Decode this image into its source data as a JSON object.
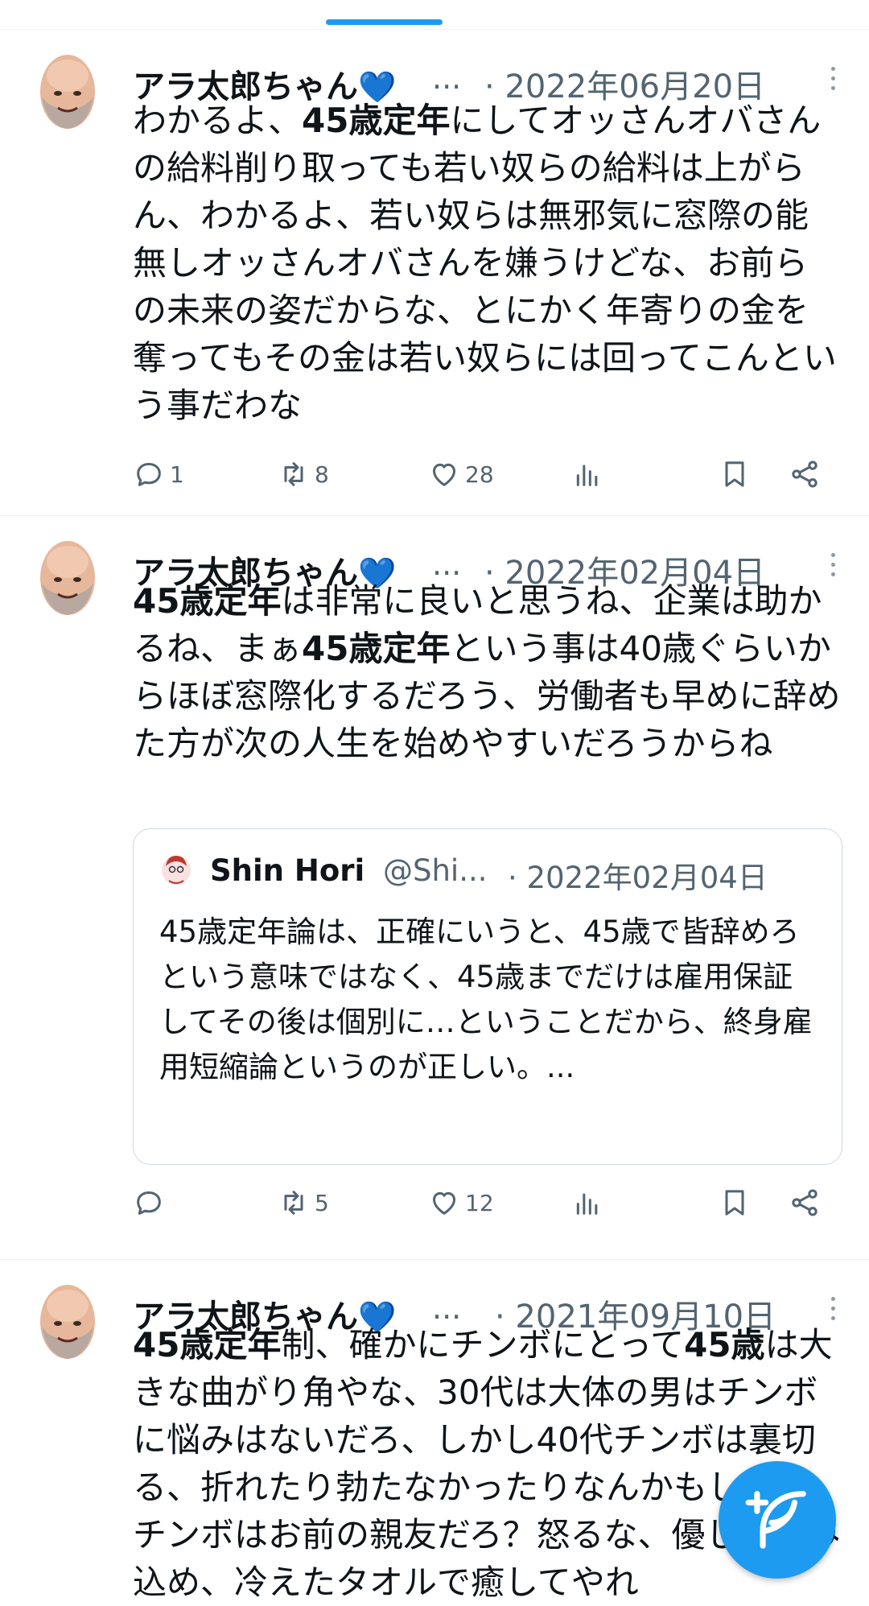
{
  "tweets": [
    {
      "author": "アラ太郎ちゃん",
      "author_badge": "💙",
      "author_ellipsis": "...",
      "date": "· 2022年06月20日",
      "text": [
        {
          "t": "わかるよ、",
          "b": false
        },
        {
          "t": "45歳定年",
          "b": true
        },
        {
          "t": "にしてオッさんオバさんの給料削り取っても若い奴らの給料は上がらん、わかるよ、若い奴らは無邪気に窓際の能無しオッさんオバさんを嫌うけどな、お前らの未来の姿だからな、とにかく年寄りの金を奪ってもその金は若い奴らには回ってこんという事だわな",
          "b": false
        }
      ],
      "replies": "1",
      "retweets": "8",
      "likes": "28"
    },
    {
      "author": "アラ太郎ちゃん",
      "author_badge": "💙",
      "author_ellipsis": "...",
      "date": "· 2022年02月04日",
      "text": [
        {
          "t": "45歳定年",
          "b": true
        },
        {
          "t": "は非常に良いと思うね、企業は助かるね、まぁ",
          "b": false
        },
        {
          "t": "45歳定年",
          "b": true
        },
        {
          "t": "という事は40歳ぐらいからほぼ窓際化するだろう、労働者も早めに辞めた方が次の人生を始めやすいだろうからね",
          "b": false
        }
      ],
      "quote": {
        "name": "Shin Hori",
        "handle": "@Shi...",
        "date": "· 2022年02月04日",
        "text": "45歳定年論は、正確にいうと、45歳で皆辞めろという意味ではなく、45歳までだけは雇用保証してその後は個別に…ということだから、終身雇用短縮論というのが正しい。..."
      },
      "replies": "",
      "retweets": "5",
      "likes": "12"
    },
    {
      "author": "アラ太郎ちゃん",
      "author_badge": "💙",
      "author_ellipsis": "...",
      "date": "· 2021年09月10日",
      "text": [
        {
          "t": "45歳定年",
          "b": true
        },
        {
          "t": "制、確かにチンボにとって",
          "b": false
        },
        {
          "t": "45歳",
          "b": true
        },
        {
          "t": "は大きな曲がり角やな、30代は大体の男はチンボに悩みはないだろ、しかし40代チンボは裏切る、折れたり勃たなかったりなんかもしな、チンボはお前の親友だろ？怒るな、優しく包み込め、冷えたタオルで癒してやれ",
          "b": false
        }
      ]
    }
  ],
  "icons": [
    "reply-icon",
    "retweet-icon",
    "like-icon",
    "views-icon",
    "bookmark-icon",
    "share-icon",
    "more-icon",
    "compose-icon"
  ],
  "colors": {
    "accent": "#1d9bf0",
    "muted": "#536471",
    "divider": "#eff3f4"
  }
}
